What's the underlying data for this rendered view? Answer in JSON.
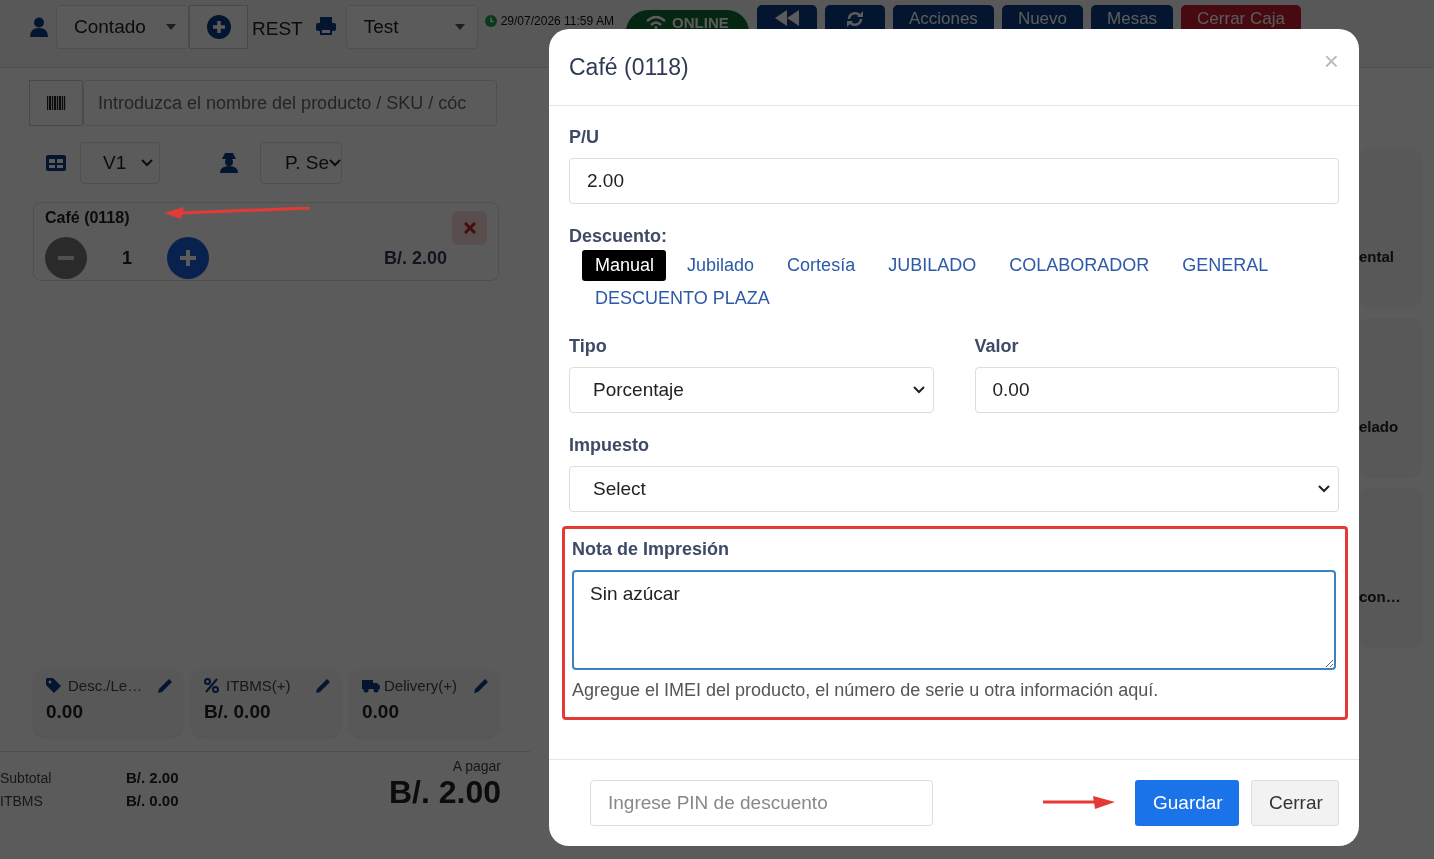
{
  "header": {
    "customer_select": "Contado",
    "register_label": "REST",
    "printer_select": "Test",
    "datetime": "29/07/2026 11:59 AM",
    "status": "ONLINE",
    "buttons": [
      {
        "label": "Acciones",
        "kind": "primary"
      },
      {
        "label": "Nuevo",
        "kind": "primary"
      },
      {
        "label": "Mesas",
        "kind": "primary"
      },
      {
        "label": "Cerrar Caja",
        "kind": "danger"
      }
    ]
  },
  "search": {
    "placeholder": "Introduzca el nombre del producto / SKU / cóc"
  },
  "table_select": "V1",
  "waiter_select": "P. Se",
  "cart": [
    {
      "name": "Café (0118)",
      "quantity": "1",
      "price": "B/. 2.00"
    }
  ],
  "adjustments": [
    {
      "kind": "discount",
      "label": "Desc./Le…",
      "value": "0.00"
    },
    {
      "kind": "tax",
      "label": "ITBMS(+)",
      "value": "B/. 0.00"
    },
    {
      "kind": "delivery",
      "label": "Delivery(+)",
      "value": "0.00"
    }
  ],
  "totals": {
    "rows": [
      {
        "label": "Subtotal",
        "value": "B/. 2.00"
      },
      {
        "label": "ITBMS",
        "value": "B/. 0.00"
      }
    ],
    "due_label": "A pagar",
    "due": "B/. 2.00"
  },
  "products": [
    {
      "name": "ental"
    },
    {
      "name": "elado"
    },
    {
      "name": "con…"
    }
  ],
  "modal": {
    "title": "Café (0118)",
    "close": "×",
    "unit_price": {
      "label": "P/U",
      "value": "2.00"
    },
    "discount": {
      "label": "Descuento:",
      "options": [
        {
          "label": "Manual",
          "selected": true
        },
        {
          "label": "Jubilado",
          "selected": false
        },
        {
          "label": "Cortesía",
          "selected": false
        },
        {
          "label": "JUBILADO",
          "selected": false
        },
        {
          "label": "COLABORADOR",
          "selected": false
        },
        {
          "label": "GENERAL",
          "selected": false
        },
        {
          "label": "DESCUENTO PLAZA",
          "selected": false
        }
      ]
    },
    "type": {
      "label": "Tipo",
      "value": "Porcentaje"
    },
    "amount": {
      "label": "Valor",
      "value": "0.00"
    },
    "tax": {
      "label": "Impuesto",
      "value": "Select"
    },
    "note": {
      "label": "Nota de Impresión",
      "value": "Sin azúcar",
      "help": "Agregue el IMEI del producto, el número de serie u otra información aquí.",
      "highlighted": true
    },
    "pin": {
      "placeholder": "Ingrese PIN de descuento"
    },
    "buttons": [
      {
        "label": "Guardar",
        "kind": "primary"
      },
      {
        "label": "Cerrar",
        "kind": "secondary"
      }
    ]
  }
}
